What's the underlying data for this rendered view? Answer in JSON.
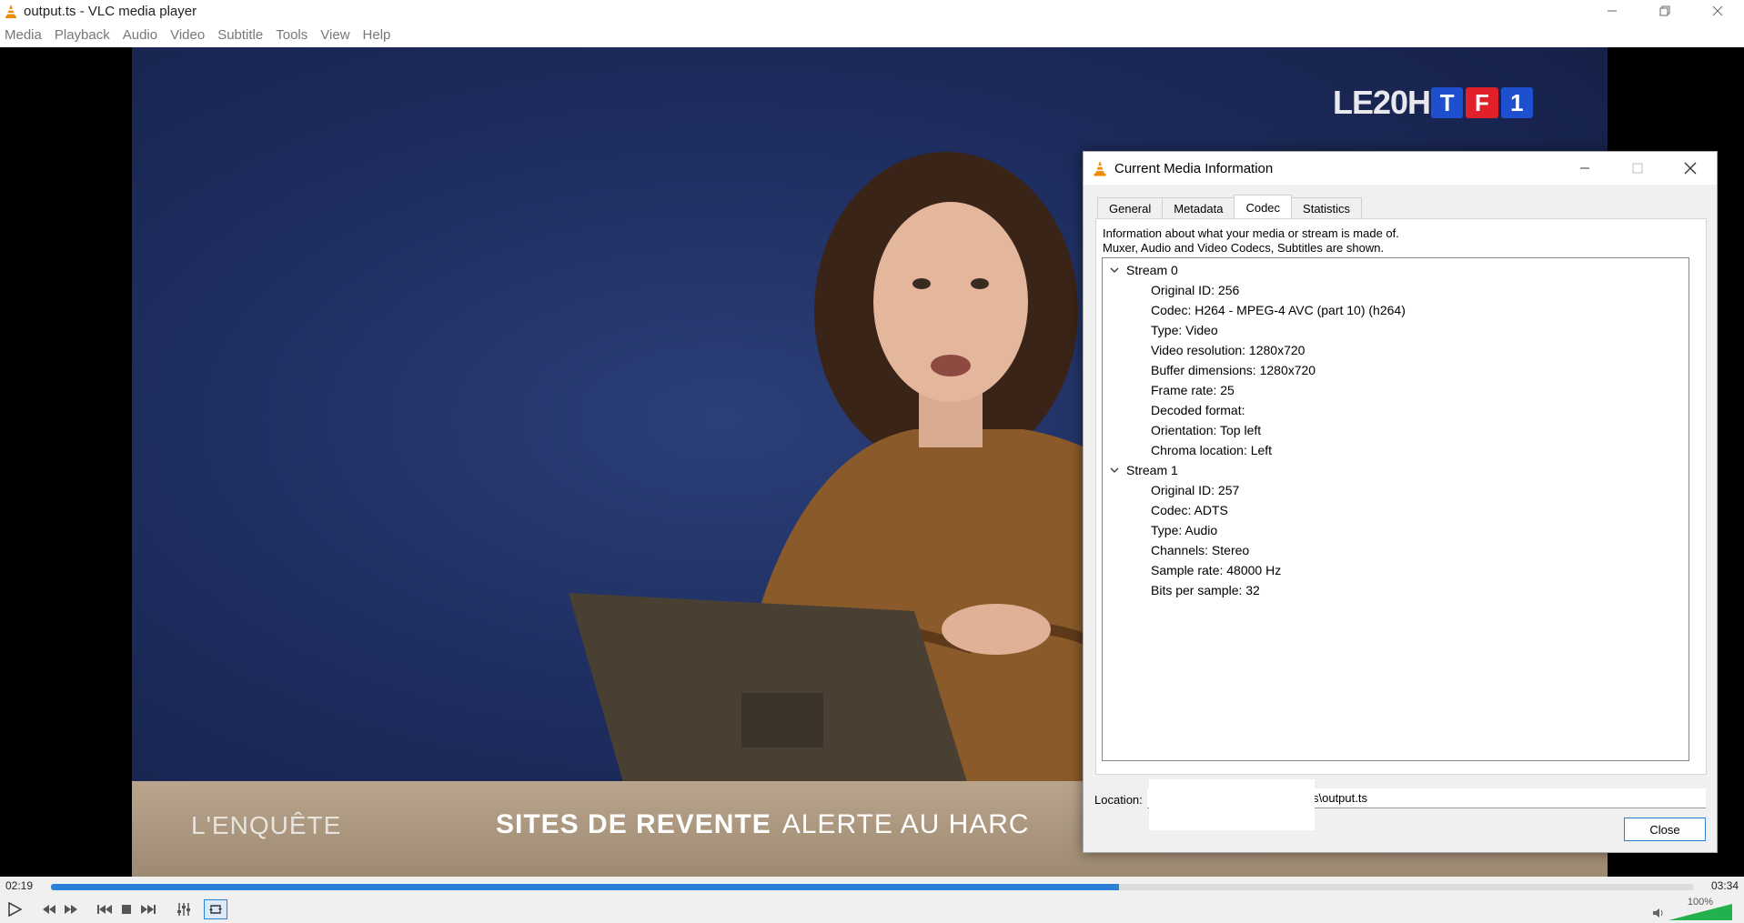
{
  "window": {
    "title": "output.ts - VLC media player",
    "controls": [
      "minimize-icon",
      "restore-icon",
      "close-icon"
    ]
  },
  "menu": [
    "Media",
    "Playback",
    "Audio",
    "Video",
    "Subtitle",
    "Tools",
    "View",
    "Help"
  ],
  "video": {
    "channel_text": "LE20H",
    "channel_logo": [
      "T",
      "F",
      "1"
    ],
    "lower_third_left": "L'ENQUÊTE",
    "lower_third_title": "SITES DE REVENTE",
    "lower_third_sub": "ALERTE AU HARC",
    "logo_colors": [
      "#1d4fcf",
      "#e0202a",
      "#1d4fcf"
    ]
  },
  "playback": {
    "elapsed": "02:19",
    "total": "03:34",
    "progress": 0.65,
    "volume_label": "100%",
    "volume_level": 1.0,
    "accent": "#2a7fd6"
  },
  "dialog": {
    "title": "Current Media Information",
    "tabs": [
      "General",
      "Metadata",
      "Codec",
      "Statistics"
    ],
    "active_tab": "Codec",
    "description_line1": "Information about what your media or stream is made of.",
    "description_line2": "Muxer, Audio and Video Codecs, Subtitles are shown.",
    "streams": [
      {
        "name": "Stream 0",
        "details": [
          "Original ID: 256",
          "Codec: H264 - MPEG-4 AVC (part 10) (h264)",
          "Type: Video",
          "Video resolution: 1280x720",
          "Buffer dimensions: 1280x720",
          "Frame rate: 25",
          "Decoded format:",
          "Orientation: Top left",
          "Chroma location: Left"
        ]
      },
      {
        "name": "Stream 1",
        "details": [
          "Original ID: 257",
          "Codec: ADTS",
          "Type: Audio",
          "Channels: Stereo",
          "Sample rate: 48000 Hz",
          "Bits per sample: 32"
        ]
      }
    ],
    "location_label": "Location:",
    "location_value": "s\\output.ts",
    "close_label": "Close"
  }
}
